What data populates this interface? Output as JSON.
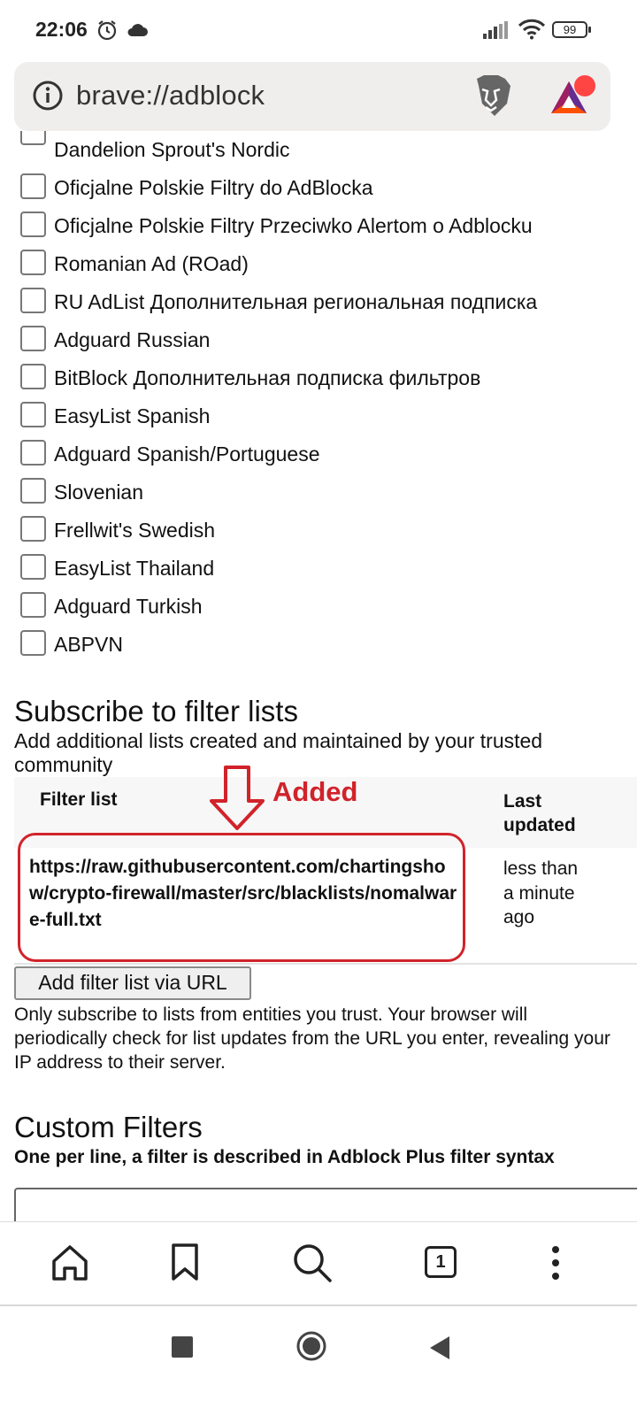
{
  "status_bar": {
    "time": "22:06",
    "battery": "99"
  },
  "url_bar": {
    "url": "brave://adblock"
  },
  "filter_lists": [
    "Dandelion Sprout's Nordic",
    "Oficjalne Polskie Filtry do AdBlocka",
    "Oficjalne Polskie Filtry Przeciwko Alertom o Adblocku",
    "Romanian Ad (ROad)",
    "RU AdList Дополнительная региональная подписка",
    "Adguard Russian",
    "BitBlock Дополнительная подписка фильтров",
    "EasyList Spanish",
    "Adguard Spanish/Portuguese",
    "Slovenian",
    "Frellwit's Swedish",
    "EasyList Thailand",
    "Adguard Turkish",
    "ABPVN"
  ],
  "subscribe": {
    "title": "Subscribe to filter lists",
    "description": "Add additional lists created and maintained by your trusted community",
    "table": {
      "col_filter": "Filter list",
      "col_updated": "Last updated",
      "rows": [
        {
          "url": "https://raw.githubusercontent.com/chartingshow/crypto-firewall/master/src/blacklists/nomalware-full.txt",
          "updated": "less than a minute ago"
        }
      ]
    },
    "annotation": "Added",
    "add_button": "Add filter list via URL",
    "warning": "Only subscribe to lists from entities you trust. Your browser will periodically check for list updates from the URL you enter, revealing your IP address to their server."
  },
  "custom_filters": {
    "title": "Custom Filters",
    "description": "One per line, a filter is described in Adblock Plus filter syntax"
  },
  "toolbar": {
    "tab_count": "1"
  },
  "colors": {
    "annotation": "#d1232a",
    "urlbar_bg": "#f0eeed"
  }
}
